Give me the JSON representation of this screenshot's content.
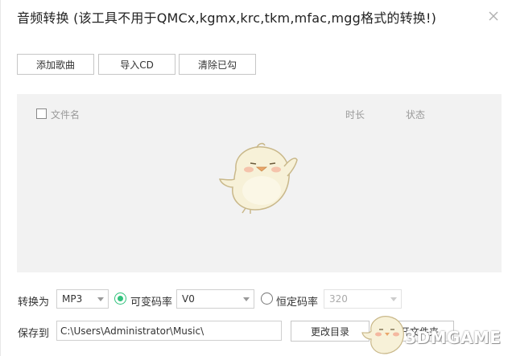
{
  "dialog": {
    "title": "音频转换 (该工具不用于QMCx,kgmx,krc,tkm,mfac,mgg格式的转换!)",
    "close_icon": "close-icon"
  },
  "toolbar": {
    "add_song_label": "添加歌曲",
    "import_cd_label": "导入CD",
    "clear_checked_label": "清除已勾"
  },
  "list": {
    "columns": {
      "filename": "文件名",
      "duration": "时长",
      "status": "状态"
    },
    "select_all_checked": false,
    "empty_illustration": "mascot-illustration"
  },
  "convert": {
    "label": "转换为",
    "format_value": "MP3",
    "vbr_label": "可变码率",
    "vbr_selected": true,
    "vbr_value": "V0",
    "cbr_label": "恒定码率",
    "cbr_selected": false,
    "cbr_value": "320"
  },
  "save": {
    "label": "保存到",
    "path": "C:\\Users\\Administrator\\Music\\",
    "change_dir_label": "更改目录",
    "open_folder_label": "打开文件夹"
  },
  "watermark": {
    "text": "3DMGAME"
  },
  "colors": {
    "accent": "#31c27c",
    "list_bg": "#f2f2f2",
    "border": "#c6c6c6"
  }
}
